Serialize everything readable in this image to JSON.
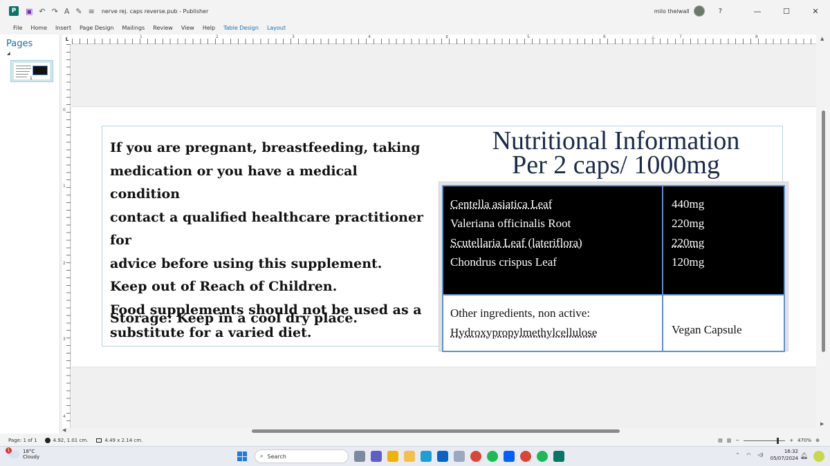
{
  "window": {
    "title": "nerve rej. caps reverse.pub  -  Publisher",
    "user": "milo thelwall",
    "help": "?",
    "minimize": "—",
    "maximize": "☐",
    "close": "✕"
  },
  "ribbon": {
    "tabs": [
      "File",
      "Home",
      "Insert",
      "Page Design",
      "Mailings",
      "Review",
      "View",
      "Help",
      "Table Design",
      "Layout"
    ]
  },
  "pages_pane": {
    "title": "Pages",
    "thumb_number": "1"
  },
  "rulers": {
    "corner": "L",
    "h_numbers": [
      "1",
      "2",
      "3",
      "4",
      "5",
      "6",
      "7",
      "8",
      "9"
    ],
    "v_numbers": [
      "0",
      "1",
      "2",
      "3",
      "4"
    ]
  },
  "document": {
    "warning_lines": [
      "If you are pregnant, breastfeeding, taking",
      "medication or you have a medical condition",
      "contact a qualified healthcare practitioner for",
      "advice before using this supplement.",
      "Keep out of Reach of Children.",
      "Food supplements should not be used as a",
      "substitute for a varied diet."
    ],
    "storage": "Storage: Keep in a cool dry place.",
    "ni_title_line1": "Nutritional Information",
    "ni_title_line2": "Per 2 caps/ 1000mg",
    "ingredients": [
      {
        "name": "Centella asiatica  Leaf",
        "amount": "440mg"
      },
      {
        "name": "Valeriana officinalis Root",
        "amount": "220mg"
      },
      {
        "name": "Scutellaria Leaf   (lateriflora)",
        "amount": "220mg"
      },
      {
        "name": "Chondrus crispus Leaf",
        "amount": "120mg"
      }
    ],
    "other_label": "Other ingredients, non active:",
    "other_value": "Hydroxypropylmethylcellulose",
    "capsule": "Vegan Capsule"
  },
  "statusbar": {
    "page": "Page: 1 of 1",
    "position": "4.92, 1.01 cm.",
    "size": "4.49 x  2.14 cm.",
    "zoom": "470%"
  },
  "taskbar": {
    "weather_badge": "1",
    "temp": "18°C",
    "condition": "Cloudy",
    "search_placeholder": "Search",
    "time": "16:32",
    "date": "05/07/2024"
  },
  "colors": {
    "accent": "#1a6fa8",
    "table_border": "#5b8fd6",
    "title_navy": "#1a2a4a"
  }
}
